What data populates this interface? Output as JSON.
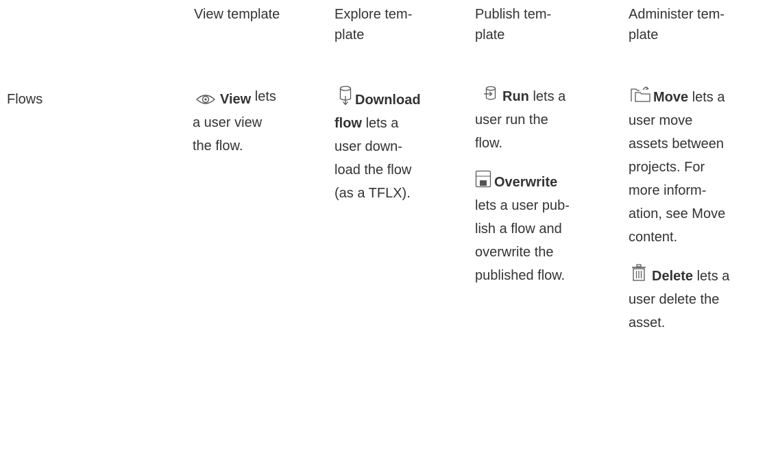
{
  "headers": [
    {
      "lines": [
        "View template"
      ]
    },
    {
      "lines": [
        "Explore tem-",
        "plate"
      ]
    },
    {
      "lines": [
        "Publish tem-",
        "plate"
      ]
    },
    {
      "lines": [
        "Administer tem-",
        "plate"
      ]
    }
  ],
  "row_label": "Flows",
  "view_cell": {
    "icon": "eye-icon",
    "name": "View",
    "first_text": "lets",
    "lines": [
      "a user view",
      "the flow."
    ]
  },
  "explore_cell": {
    "icon": "download-flow-icon",
    "name_line1": "Download",
    "name_line2": "flow",
    "line2_text": "lets a",
    "lines": [
      "user down-",
      "load the flow",
      "(as a TFLX)."
    ]
  },
  "publish_cell": {
    "run": {
      "icon": "run-flow-icon",
      "name": "Run",
      "first_text": "lets a",
      "lines": [
        "user run the",
        "flow."
      ]
    },
    "overwrite": {
      "icon": "overwrite-icon",
      "name": "Overwrite",
      "lines": [
        "lets a user pub-",
        "lish a flow and",
        "overwrite the",
        "published flow."
      ]
    }
  },
  "administer_cell": {
    "move": {
      "icon": "move-icon",
      "name": "Move",
      "first_text": "lets a",
      "lines": [
        "user move",
        "assets between",
        "projects. For",
        "more inform-",
        "ation, see Move",
        "content."
      ]
    },
    "delete": {
      "icon": "trash-icon",
      "name": "Delete",
      "first_text": "lets a",
      "lines": [
        "user delete the",
        "asset."
      ]
    }
  },
  "colors": {
    "text": "#333333",
    "icon": "#555555"
  }
}
